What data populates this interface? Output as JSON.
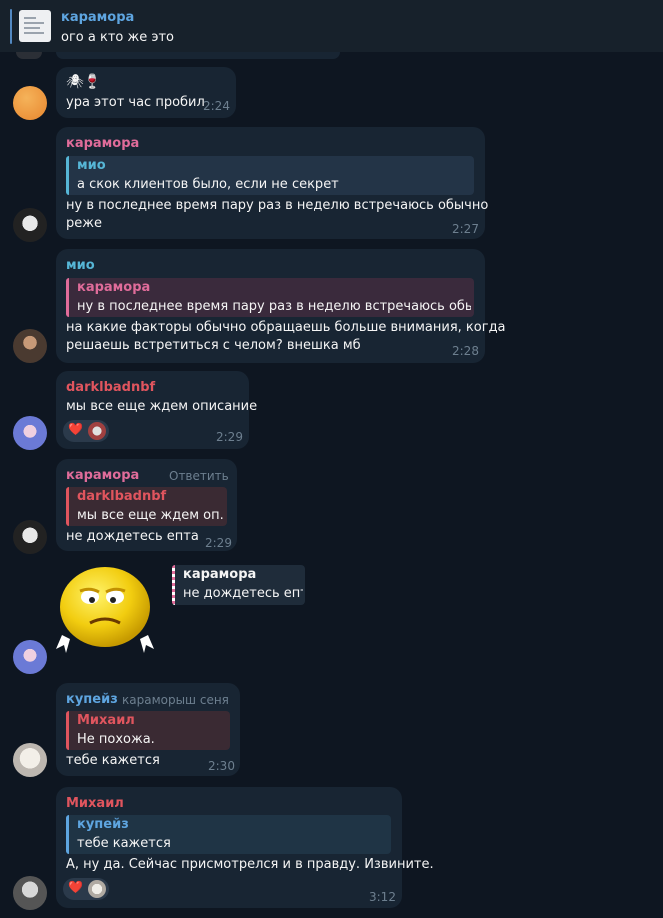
{
  "pinned": {
    "name": "карамора",
    "text": "ого а кто же это"
  },
  "messages": [
    {
      "emoji_line": "🕷🍷",
      "text": "ура этот час пробил",
      "time": "2:24"
    },
    {
      "sender": "карамора",
      "reply_name": "мио",
      "reply_text": "а скок клиентов было, если не секрет",
      "text_line1": "ну в последнее время пару раз в неделю встречаюсь обычно",
      "text_line2": "реже",
      "time": "2:27"
    },
    {
      "sender": "мио",
      "reply_name": "карамора",
      "reply_text": "ну в последнее время пару раз в неделю встречаюсь обычно...",
      "text_line1": "на какие факторы обычно обращаешь больше внимания, когда",
      "text_line2": "решаешь встретиться с челом? внешка мб",
      "time": "2:28"
    },
    {
      "sender": "darklbadnbf",
      "text": "мы все еще ждем описание",
      "reaction": "❤️",
      "time": "2:29"
    },
    {
      "sender": "карамора",
      "action": "Ответить",
      "reply_name": "darklbadnbf",
      "reply_text": "мы все еще ждем оп...",
      "text": "не дождетесь епта",
      "time": "2:29"
    },
    {
      "sticker_reply_name": "карамора",
      "sticker_reply_text": "не дождетесь епта"
    },
    {
      "sender": "купейз",
      "sender_rank": "караморыш сеня",
      "reply_name": "Михаил",
      "reply_text": "Не похожа.",
      "text": "тебе кажется",
      "time": "2:30"
    },
    {
      "sender": "Михаил",
      "reply_name": "купейз",
      "reply_text": "тебе кажется",
      "text": "А, ну да. Сейчас присмотрелся и в правду. Извините.",
      "reaction": "❤️",
      "time": "3:12"
    }
  ],
  "colors": {
    "background": "#0e1621",
    "bubble": "#182533",
    "pink": "#e06c9a",
    "blue": "#5ea5e0",
    "red": "#e0555e",
    "cyan": "#56b6d6"
  }
}
